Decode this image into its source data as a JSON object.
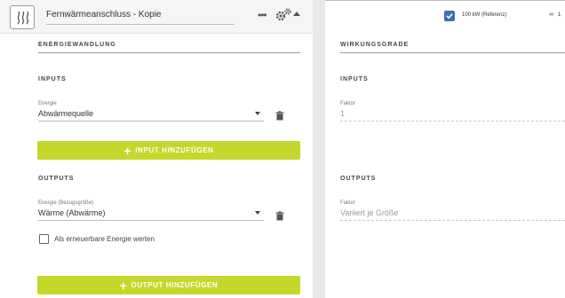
{
  "header": {
    "title": "Fernwärmeanschluss  - Kopie",
    "icons": {
      "app": "heat-waves-icon",
      "more": "dots-icon",
      "settings": "gears-icon",
      "collapse": "caret-up-icon"
    }
  },
  "left": {
    "section_title": "ENERGIEWANDLUNG",
    "inputs": {
      "title": "INPUTS",
      "field_label": "Energie",
      "field_value": "Abwärmequelle",
      "add_button": "INPUT HINZUFÜGEN"
    },
    "outputs": {
      "title": "OUTPUTS",
      "field_label": "Energie (Bezugsgröße)",
      "field_value": "Wärme (Abwärme)",
      "checkbox_label": "Als erneuerbare Energie werten",
      "checkbox_checked": false,
      "add_button": "OUTPUT HINZUFÜGEN"
    }
  },
  "right": {
    "reference_label": "100 kW (Referenz)",
    "reference_checked": true,
    "link_text": "1",
    "section_title": "WIRKUNGSGRADE",
    "inputs": {
      "title": "INPUTS",
      "field_label": "Faktor",
      "field_value": "1"
    },
    "outputs": {
      "title": "OUTPUTS",
      "field_label": "Faktor",
      "field_value": "Variiert je Größe"
    }
  },
  "colors": {
    "accent": "#c6d72b",
    "checkbox_blue": "#3a6fb0"
  }
}
